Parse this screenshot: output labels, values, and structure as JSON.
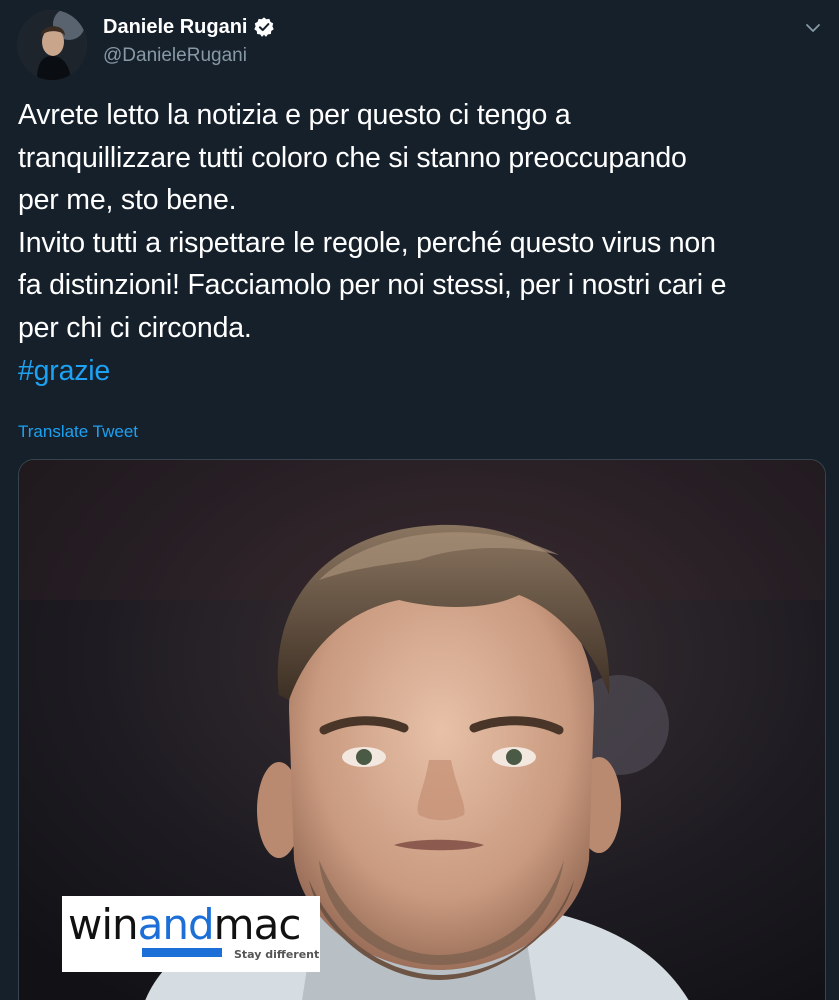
{
  "author": {
    "display_name": "Daniele Rugani",
    "handle": "@DanieleRugani",
    "verified": true
  },
  "icons": {
    "verified": "verified-badge-icon",
    "menu": "chevron-down-icon"
  },
  "tweet": {
    "lines": [
      "Avrete letto la notizia e per questo ci tengo a",
      "tranquillizzare tutti coloro che si stanno preoccupando",
      "per me, sto bene.",
      "Invito tutti a rispettare le regole, perché questo virus non",
      "fa distinzioni! Facciamolo per noi stessi, per i nostri cari e",
      "per chi ci circonda."
    ],
    "hashtag": "#grazie",
    "translate_label": "Translate Tweet"
  },
  "media": {
    "watermark_prefix": "win",
    "watermark_and": "and",
    "watermark_suffix": "mac",
    "watermark_tagline": "Stay different"
  },
  "colors": {
    "background": "#15202b",
    "text": "#ffffff",
    "secondary": "#8899a6",
    "accent": "#1da1f2",
    "border": "#38444d"
  }
}
